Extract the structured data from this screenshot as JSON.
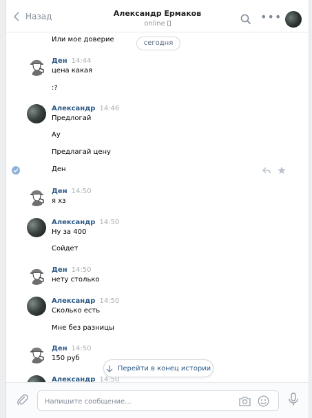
{
  "header": {
    "back_label": "Назад",
    "title": "Александр Ермаков",
    "status": "online"
  },
  "date_chip": "сегодня",
  "messages": {
    "m0": {
      "text": "Или мое доверие"
    },
    "m1": {
      "author": "Ден",
      "time": "14:44",
      "lines": [
        "цена какая",
        ":?"
      ]
    },
    "m2": {
      "author": "Александр",
      "time": "14:46",
      "lines": [
        "Предлогай",
        "Ау",
        "Предлагай цену",
        "Ден"
      ]
    },
    "m3": {
      "author": "Ден",
      "time": "14:50",
      "lines": [
        "я хз"
      ]
    },
    "m4": {
      "author": "Александр",
      "time": "14:50",
      "lines": [
        "Ну за 400",
        "Сойдет"
      ]
    },
    "m5": {
      "author": "Ден",
      "time": "14:50",
      "lines": [
        "нету столько"
      ]
    },
    "m6": {
      "author": "Александр",
      "time": "14:50",
      "lines": [
        "Сколько есть",
        "Мне без разницы"
      ]
    },
    "m7": {
      "author": "Ден",
      "time": "14:50",
      "lines": [
        "150 руб"
      ]
    },
    "m8": {
      "author": "Александр",
      "time": "14:50"
    }
  },
  "jump_button": "Перейти в конец истории",
  "composer": {
    "placeholder": "Напишите сообщение..."
  },
  "colors": {
    "link": "#2a5885",
    "muted": "#818c99",
    "check": "#8fb0d6"
  }
}
